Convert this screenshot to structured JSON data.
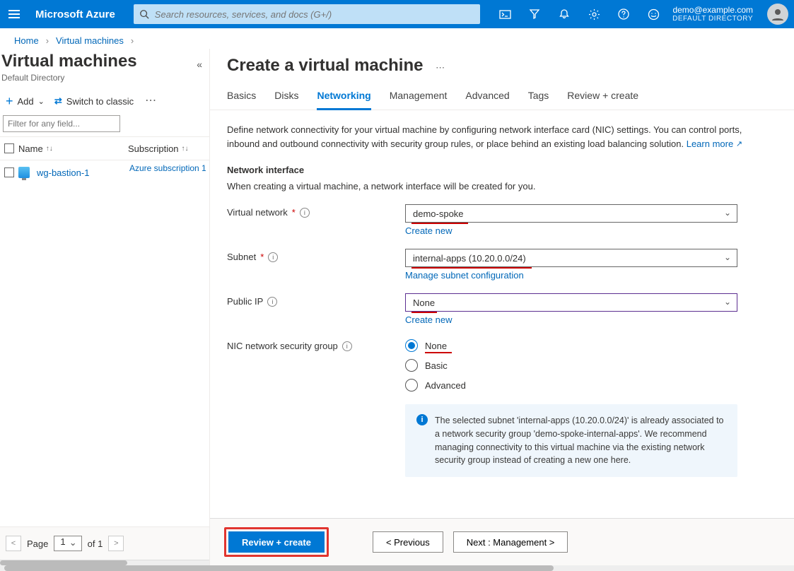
{
  "header": {
    "brand": "Microsoft Azure",
    "search_placeholder": "Search resources, services, and docs (G+/)",
    "account_email": "demo@example.com",
    "account_directory": "DEFAULT DIRECTORY"
  },
  "breadcrumb": {
    "home": "Home",
    "vm": "Virtual machines"
  },
  "left": {
    "title": "Virtual machines",
    "subtitle": "Default Directory",
    "add_label": "Add",
    "switch_label": "Switch to classic",
    "filter_placeholder": "Filter for any field...",
    "col_name": "Name",
    "col_sub": "Subscription",
    "row_name": "wg-bastion-1",
    "row_sub": "Azure subscription 1",
    "pager_page": "Page",
    "pager_current": "1",
    "pager_of": "of 1"
  },
  "right": {
    "title": "Create a virtual machine",
    "tabs": [
      "Basics",
      "Disks",
      "Networking",
      "Management",
      "Advanced",
      "Tags",
      "Review + create"
    ],
    "desc": "Define network connectivity for your virtual machine by configuring network interface card (NIC) settings. You can control ports, inbound and outbound connectivity with security group rules, or place behind an existing load balancing solution.",
    "learn_more": "Learn more",
    "ni_heading": "Network interface",
    "ni_sub": "When creating a virtual machine, a network interface will be created for you.",
    "vnet_label": "Virtual network",
    "vnet_value": "demo-spoke",
    "create_new": "Create new",
    "subnet_label": "Subnet",
    "subnet_value": "internal-apps (10.20.0.0/24)",
    "manage_subnet": "Manage subnet configuration",
    "pip_label": "Public IP",
    "pip_value": "None",
    "nsg_label": "NIC network security group",
    "nsg_options": [
      "None",
      "Basic",
      "Advanced"
    ],
    "info_text": "The selected subnet 'internal-apps (10.20.0.0/24)' is already associated to a network security group 'demo-spoke-internal-apps'. We recommend managing connectivity to this virtual machine via the existing network security group instead of creating a new one here.",
    "btn_review": "Review + create",
    "btn_prev": "< Previous",
    "btn_next": "Next : Management >"
  }
}
